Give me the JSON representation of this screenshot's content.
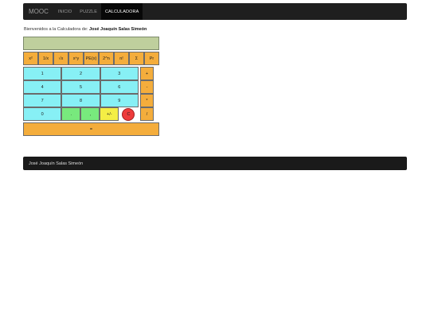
{
  "nav": {
    "brand": "MOOC",
    "links": [
      "INICIO",
      "PUZZLE",
      "CALCULADORA"
    ],
    "active": "CALCULADORA"
  },
  "welcome": {
    "prefix": "Bienvenidos a la Calculadora de:",
    "name": "José Joaquín Salas Simeón"
  },
  "display": {
    "value": ""
  },
  "functions": [
    "x²",
    "1/x",
    "√x",
    "xⁿy",
    "PE(x)",
    "2^n",
    "n!",
    "Σ",
    "Pr"
  ],
  "digits": [
    [
      "1",
      "2",
      "3"
    ],
    [
      "4",
      "5",
      "6"
    ],
    [
      "7",
      "8",
      "9"
    ]
  ],
  "bottom_row": {
    "zero": "0",
    "dot": ".",
    "comma": ",",
    "sign": "+/-",
    "clear": "C"
  },
  "operators": [
    "+",
    "-",
    "*",
    "/"
  ],
  "equals": "=",
  "footer": {
    "text": "José Joaquín Salas Simeón"
  },
  "colors": {
    "navbar": "#1f1f1f",
    "display": "#bfcf9d",
    "function_key": "#f4ad3c",
    "digit_key": "#87f0f5",
    "green_key": "#78e97d",
    "yellow_key": "#f4ee45",
    "clear_key": "#ee3b3b"
  }
}
